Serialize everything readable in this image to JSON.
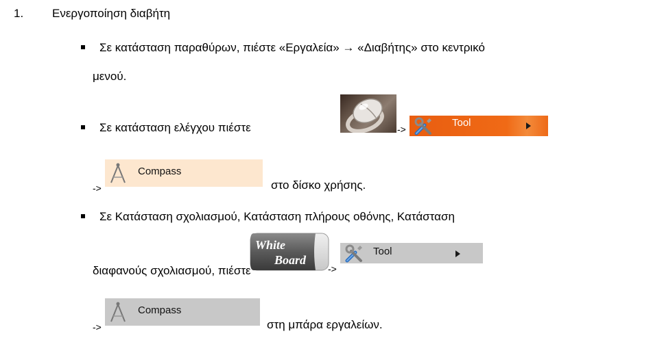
{
  "heading": {
    "number": "1.",
    "text": "Ενεργοποίηση διαβήτη"
  },
  "item1": {
    "line1": "Σε κατάσταση παραθύρων, πιέστε «Εργαλεία» → «Διαβήτης» στο κεντρικό",
    "line2": "μενού."
  },
  "item2": {
    "text": "Σε κατάσταση ελέγχου πιέστε",
    "arrow1": "->",
    "tool_label": "Tool",
    "arrow2": "->",
    "compass_label": "Compass",
    "tail": "στο δίσκο χρήσης."
  },
  "item3": {
    "line1": "Σε Κατάσταση σχολιασμού, Κατάσταση πλήρους οθόνης, Κατάσταση",
    "line2": "διαφανούς σχολιασμού, πιέστε",
    "whiteboard_logo_text": "White Board",
    "arrow1": "->",
    "tool_label": "Tool",
    "arrow2": "->",
    "compass_label": "Compass",
    "tail": "στη μπάρα εργαλείων."
  },
  "colors": {
    "tool_orange": "#ee6410",
    "tool_gray": "#c8c8c8",
    "compass_peach": "#fde7cf"
  }
}
